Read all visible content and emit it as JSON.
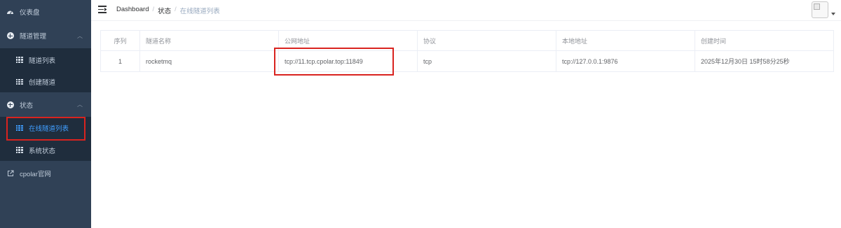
{
  "sidebar": {
    "dashboard": "仪表盘",
    "tunnel_manage": "隧道管理",
    "tunnel_list": "隧道列表",
    "create_tunnel": "创建隧道",
    "status": "状态",
    "online_tunnels": "在线隧道列表",
    "system_status": "系统状态",
    "official_site": "cpolar官网",
    "colors": {
      "bg": "#304156",
      "submenu_bg": "#1f2d3d",
      "active": "#409eff",
      "highlight": "#d9231f"
    }
  },
  "header": {
    "breadcrumb": {
      "home": "Dashboard",
      "sep": "/",
      "level1": "状态",
      "current": "在线隧道列表"
    }
  },
  "table": {
    "columns": [
      "序列",
      "隧道名称",
      "公网地址",
      "协议",
      "本地地址",
      "创建时间"
    ],
    "rows": [
      [
        "1",
        "rocketmq",
        "tcp://11.tcp.cpolar.top:11849",
        "tcp",
        "tcp://127.0.0.1:9876",
        "2025年12月30日 15时58分25秒"
      ]
    ]
  }
}
